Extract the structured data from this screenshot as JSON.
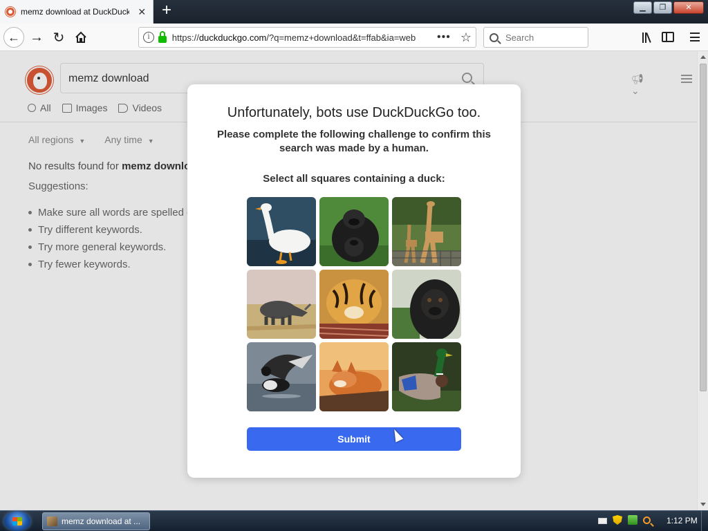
{
  "browser": {
    "tab_title": "memz download at DuckDuckGo",
    "tab_close": "✕",
    "new_tab": "+",
    "url_prefix": "https://",
    "url_host": "duckduckgo.com",
    "url_path": "/?q=memz+download&t=ffab&ia=web",
    "search_placeholder": "Search",
    "page_actions": "•••"
  },
  "window_controls": {
    "minimize": "▁",
    "maximize": "❐",
    "close": "✕"
  },
  "ddg": {
    "query": "memz download",
    "tabs": [
      {
        "label": "All",
        "icon": "search-icon"
      },
      {
        "label": "Images",
        "icon": "image-icon"
      },
      {
        "label": "Videos",
        "icon": "video-icon"
      }
    ],
    "filters": {
      "region": "All regions",
      "time": "Any time",
      "caret": "▼"
    },
    "no_results_prefix": "No results found for ",
    "no_results_query": "memz download",
    "suggestions_title": "Suggestions:",
    "suggestions": [
      "Make sure all words are spelled correctly.",
      "Try different keywords.",
      "Try more general keywords.",
      "Try fewer keywords."
    ]
  },
  "modal": {
    "heading": "Unfortunately, bots use DuckDuckGo too.",
    "lead": "Please complete the following challenge to confirm this search was made by a human.",
    "instruction": "Select all squares containing a duck:",
    "tiles": [
      {
        "subject": "white-goose"
      },
      {
        "subject": "gorillas"
      },
      {
        "subject": "giraffes"
      },
      {
        "subject": "rhino"
      },
      {
        "subject": "tiger-cub"
      },
      {
        "subject": "gorilla"
      },
      {
        "subject": "diving-duck"
      },
      {
        "subject": "fox"
      },
      {
        "subject": "mallard-duck"
      }
    ],
    "submit_label": "Submit"
  },
  "taskbar": {
    "task_label": "memz download at ...",
    "clock": "1:12 PM"
  },
  "colors": {
    "ddg_orange": "#de5833",
    "submit_blue": "#3969ef",
    "lock_green": "#12bc00"
  }
}
